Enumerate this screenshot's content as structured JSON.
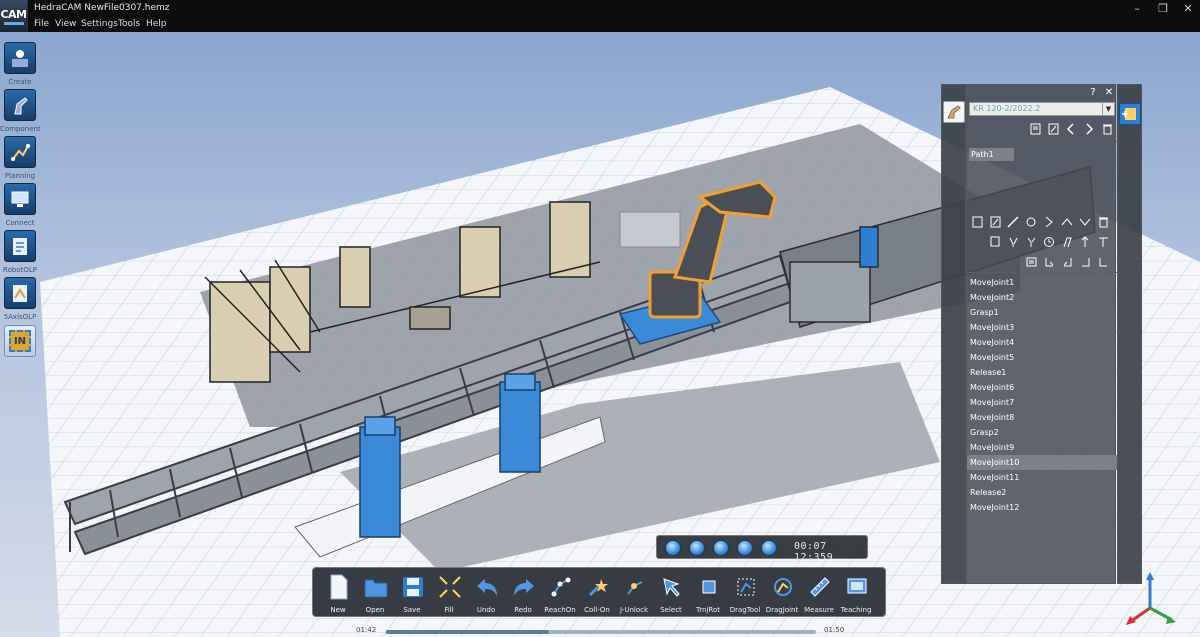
{
  "app": {
    "logo_text": "CAM",
    "title": "HedraCAM  NewFile0307.hemz",
    "window_controls": [
      "minimize-icon",
      "restore-icon",
      "close-icon"
    ]
  },
  "menu": {
    "items": [
      "File",
      "View",
      "Settings",
      "Tools",
      "Help"
    ]
  },
  "left_toolbar": {
    "items": [
      {
        "label": "Create",
        "icon": "create-icon"
      },
      {
        "label": "Component",
        "icon": "component-icon"
      },
      {
        "label": "Planning",
        "icon": "planning-icon"
      },
      {
        "label": "Connect",
        "icon": "connect-icon"
      },
      {
        "label": "RobotOLP",
        "icon": "robot-olp-icon"
      },
      {
        "label": "5AxisOLP",
        "icon": "five-axis-olp-icon"
      },
      {
        "label": "",
        "icon": "in-icon",
        "text": "IN"
      }
    ]
  },
  "panel": {
    "robot_value": "KR 120-2/2022.2",
    "path_item": "Path1",
    "commands": [
      "MoveJoint1",
      "MoveJoint2",
      "Grasp1",
      "MoveJoint3",
      "MoveJoint4",
      "MoveJoint5",
      "Release1",
      "MoveJoint6",
      "MoveJoint7",
      "MoveJoint8",
      "Grasp2",
      "MoveJoint9",
      "MoveJoint10",
      "MoveJoint11",
      "Release2",
      "MoveJoint12"
    ],
    "selected_command": "MoveJoint10"
  },
  "playback": {
    "time": "00:07  12:359"
  },
  "bottom_toolbar": {
    "buttons": [
      {
        "label": "New",
        "icon": "new-file-icon"
      },
      {
        "label": "Open",
        "icon": "open-folder-icon"
      },
      {
        "label": "Save",
        "icon": "save-icon"
      },
      {
        "label": "Fill",
        "icon": "fill-icon"
      },
      {
        "label": "Undo",
        "icon": "undo-icon"
      },
      {
        "label": "Redo",
        "icon": "redo-icon"
      },
      {
        "label": "ReachOn",
        "icon": "reach-on-icon"
      },
      {
        "label": "Coll-On",
        "icon": "collision-on-icon"
      },
      {
        "label": "J-Unlock",
        "icon": "joint-unlock-icon"
      },
      {
        "label": "Select",
        "icon": "select-icon"
      },
      {
        "label": "TrnjRot",
        "icon": "translate-rotate-icon"
      },
      {
        "label": "DragTool",
        "icon": "drag-tool-icon"
      },
      {
        "label": "DragJoint",
        "icon": "drag-joint-icon"
      },
      {
        "label": "Measure",
        "icon": "measure-icon"
      },
      {
        "label": "Teaching",
        "icon": "teaching-icon"
      }
    ]
  },
  "timeline": {
    "start": "01:42",
    "end": "01:50",
    "progress": 0.38
  },
  "colors": {
    "accent": "#2f7fd0",
    "selection_highlight": "#f0a030",
    "panel_bg": "#4a4e56"
  }
}
